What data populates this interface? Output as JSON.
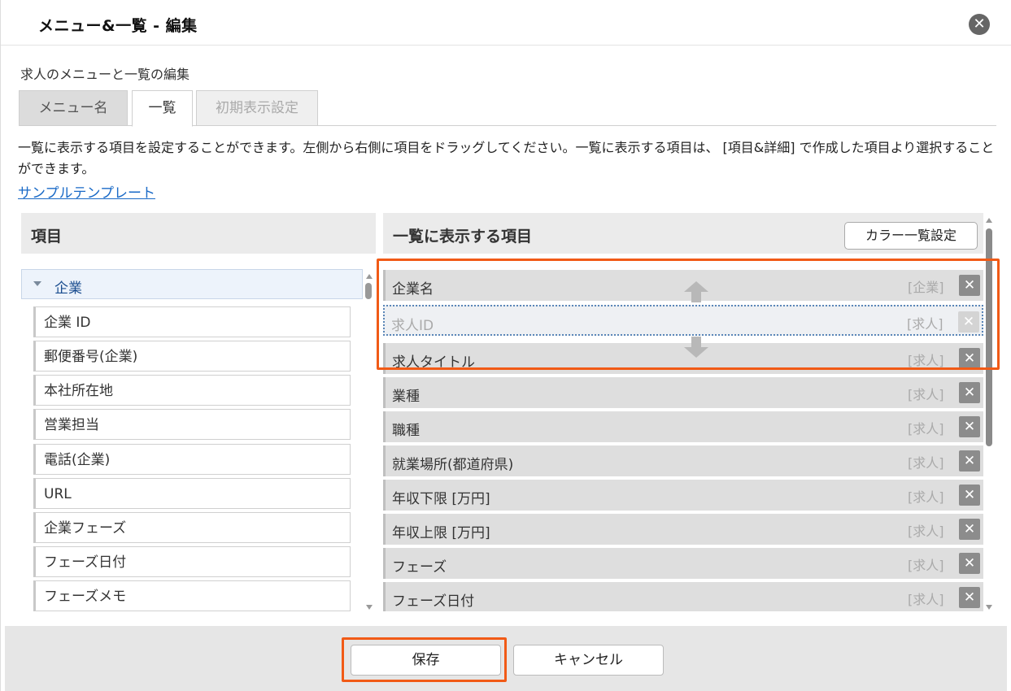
{
  "dialog": {
    "title": "メニュー&一覧 - 編集",
    "close_glyph": "✕"
  },
  "subtitle": "求人のメニューと一覧の編集",
  "tabs": [
    {
      "label": "メニュー名"
    },
    {
      "label": "一覧"
    },
    {
      "label": "初期表示設定"
    }
  ],
  "description": "一覧に表示する項目を設定することができます。左側から右側に項目をドラッグしてください。一覧に表示する項目は、 [項目&詳細] で作成した項目より選択することができます。",
  "sample_link": "サンプルテンプレート",
  "left_panel": {
    "header": "項目",
    "group": "企業",
    "items": [
      {
        "label": "企業 ID"
      },
      {
        "label": "郵便番号(企業)"
      },
      {
        "label": "本社所在地"
      },
      {
        "label": "営業担当"
      },
      {
        "label": "電話(企業)"
      },
      {
        "label": "URL"
      },
      {
        "label": "企業フェーズ"
      },
      {
        "label": "フェーズ日付"
      },
      {
        "label": "フェーズメモ"
      }
    ]
  },
  "right_panel": {
    "header": "一覧に表示する項目",
    "color_button": "カラー一覧設定",
    "remove_glyph": "✕",
    "items": [
      {
        "label": "企業名",
        "tag": "[企業]"
      },
      {
        "label": "求人ID",
        "tag": "[求人]"
      },
      {
        "label": "求人タイトル",
        "tag": "[求人]"
      },
      {
        "label": "業種",
        "tag": "[求人]"
      },
      {
        "label": "職種",
        "tag": "[求人]"
      },
      {
        "label": "就業場所(都道府県)",
        "tag": "[求人]"
      },
      {
        "label": "年収下限 [万円]",
        "tag": "[求人]"
      },
      {
        "label": "年収上限 [万円]",
        "tag": "[求人]"
      },
      {
        "label": "フェーズ",
        "tag": "[求人]"
      },
      {
        "label": "フェーズ日付",
        "tag": "[求人]"
      }
    ]
  },
  "footer": {
    "save": "保存",
    "cancel": "キャンセル"
  },
  "colors": {
    "highlight": "#f15a16",
    "link": "#1a6ac7"
  }
}
